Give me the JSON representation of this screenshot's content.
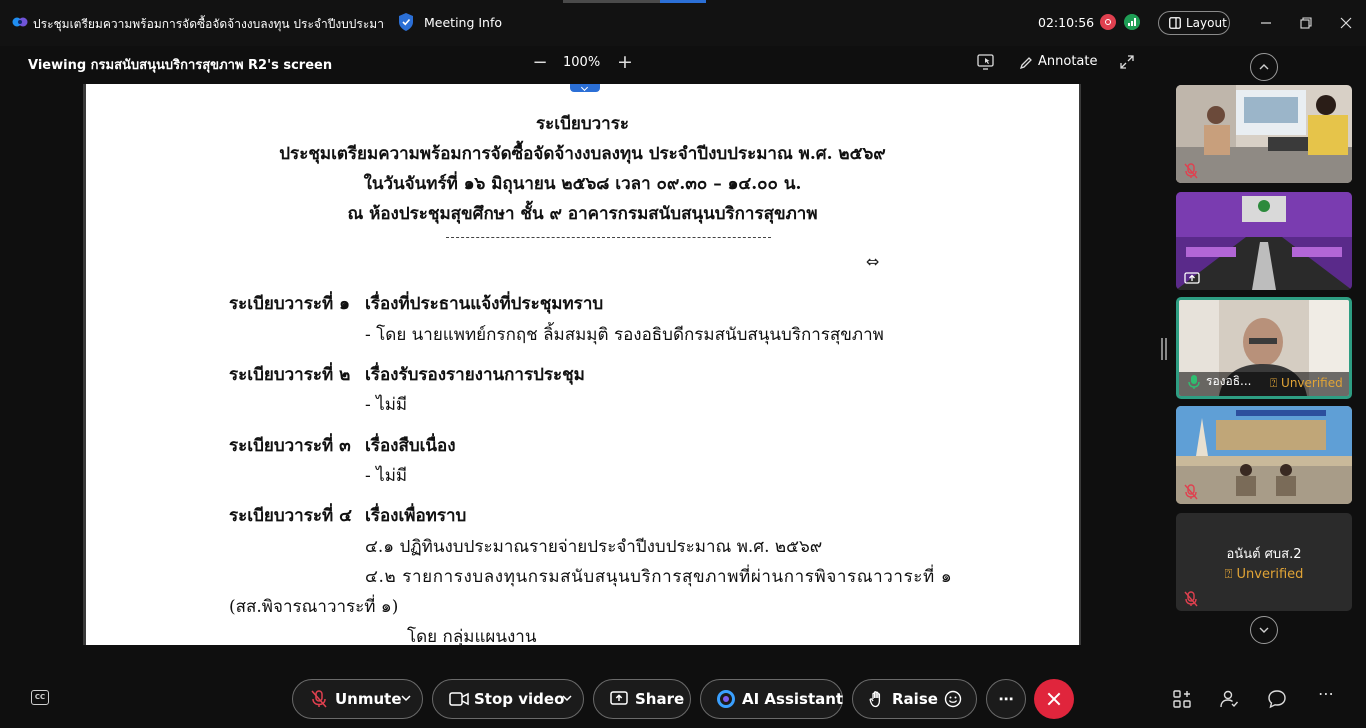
{
  "titlebar": {
    "meeting_title": "ประชุมเตรียมความพร้อมการจัดซื้อจัดจ้างงบลงทุน ประจำปีงบประมาณ...",
    "meeting_info": "Meeting Info",
    "clock": "02:10:56",
    "layout_label": "Layout"
  },
  "share_toolbar": {
    "viewing_label": "Viewing กรมสนับสนุนบริการสุขภาพ R2's screen",
    "zoom_minus": "−",
    "zoom_value": "100%",
    "zoom_plus": "+",
    "annotate_label": "Annotate"
  },
  "document": {
    "heading_1": "ระเบียบวาระ",
    "heading_2": "ประชุมเตรียมความพร้อมการจัดซื้อจัดจ้างงบลงทุน ประจำปีงบประมาณ พ.ศ. ๒๕๖๙",
    "heading_3": "ในวันจันทร์ที่ ๑๖ มิถุนายน ๒๕๖๘ เวลา ๐๙.๓๐ – ๑๔.๐๐ น.",
    "heading_4": "ณ ห้องประชุมสุขศึกษา ชั้น ๙ อาคารกรมสนับสนุนบริการสุขภาพ",
    "agenda": [
      {
        "label": "ระเบียบวาระที่ ๑",
        "title": "เรื่องที่ประธานแจ้งที่ประชุมทราบ",
        "detail": "- โดย นายแพทย์กรกฤช ลิ้มสมมุติ รองอธิบดีกรมสนับสนุนบริการสุขภาพ"
      },
      {
        "label": "ระเบียบวาระที่ ๒",
        "title": "เรื่องรับรองรายงานการประชุม",
        "detail": "- ไม่มี"
      },
      {
        "label": "ระเบียบวาระที่ ๓",
        "title": "เรื่องสืบเนื่อง",
        "detail": "- ไม่มี"
      },
      {
        "label": "ระเบียบวาระที่ ๔",
        "title": "เรื่องเพื่อทราบ"
      }
    ],
    "item_4_1": "๔.๑ ปฏิทินงบประมาณรายจ่ายประจำปีงบประมาณ พ.ศ. ๒๕๖๙",
    "item_4_2": "๔.๒ รายการงบลงทุนกรมสนับสนุนบริการสุขภาพที่ผ่านการพิจารณาวาระที่ ๑",
    "item_4_2_cont": "(สส.พิจารณาวาระที่ ๑)",
    "item_4_2_by": "โดย กลุ่มแผนงาน"
  },
  "gallery": {
    "participants": [
      {
        "name": "",
        "unverified": "",
        "muted": true
      },
      {
        "name": "",
        "unverified": "",
        "muted": false
      },
      {
        "name": "รองอธิ...",
        "unverified": "Unverified",
        "muted": false,
        "speaking": true
      },
      {
        "name": "",
        "unverified": "",
        "muted": true
      },
      {
        "name": "อนันต์ ศบส.2",
        "unverified": "Unverified",
        "muted": true
      }
    ]
  },
  "controls": {
    "unmute": "Unmute",
    "stop_video": "Stop video",
    "share": "Share",
    "ai_assistant": "AI Assistant",
    "raise": "Raise",
    "more": "⋯",
    "right_more": "⋯"
  },
  "colors": {
    "accent_blue": "#2b6fd6",
    "end_call_red": "#e0253c",
    "unverified_orange": "#e1a436",
    "active_speaker_teal": "#2e9e83"
  }
}
